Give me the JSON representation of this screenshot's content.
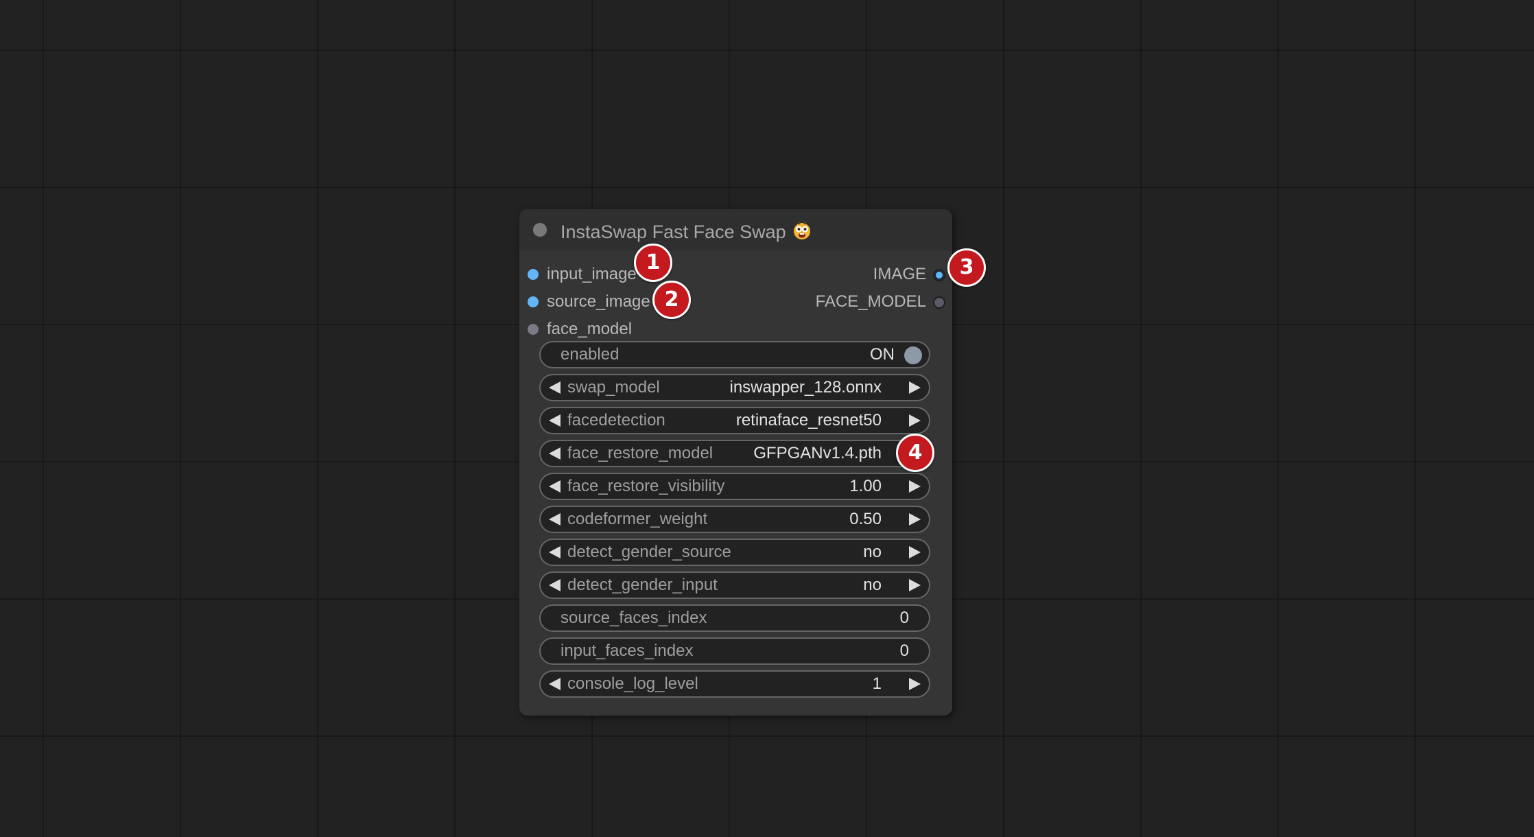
{
  "node": {
    "title": "InstaSwap Fast Face Swap",
    "title_icon": "face-emoji-icon",
    "inputs": [
      {
        "label": "input_image",
        "type_color": "#64b5f6"
      },
      {
        "label": "source_image",
        "type_color": "#64b5f6"
      },
      {
        "label": "face_model",
        "type_color": "#7a7a86"
      }
    ],
    "outputs": [
      {
        "label": "IMAGE",
        "type_color": "#64b5f6"
      },
      {
        "label": "FACE_MODEL",
        "type_color": "#5a5a66"
      }
    ],
    "widgets": {
      "enabled": {
        "label": "enabled",
        "value": "ON"
      },
      "swap_model": {
        "label": "swap_model",
        "value": "inswapper_128.onnx"
      },
      "facedetection": {
        "label": "facedetection",
        "value": "retinaface_resnet50"
      },
      "face_restore_model": {
        "label": "face_restore_model",
        "value": "GFPGANv1.4.pth"
      },
      "face_restore_visibility": {
        "label": "face_restore_visibility",
        "value": "1.00"
      },
      "codeformer_weight": {
        "label": "codeformer_weight",
        "value": "0.50"
      },
      "detect_gender_source": {
        "label": "detect_gender_source",
        "value": "no"
      },
      "detect_gender_input": {
        "label": "detect_gender_input",
        "value": "no"
      },
      "source_faces_index": {
        "label": "source_faces_index",
        "value": "0"
      },
      "input_faces_index": {
        "label": "input_faces_index",
        "value": "0"
      },
      "console_log_level": {
        "label": "console_log_level",
        "value": "1"
      }
    }
  },
  "annotations": [
    "1",
    "2",
    "3",
    "4"
  ],
  "colors": {
    "canvas_bg": "#222222",
    "node_bg": "#353535",
    "badge_red": "#c41a1f"
  }
}
